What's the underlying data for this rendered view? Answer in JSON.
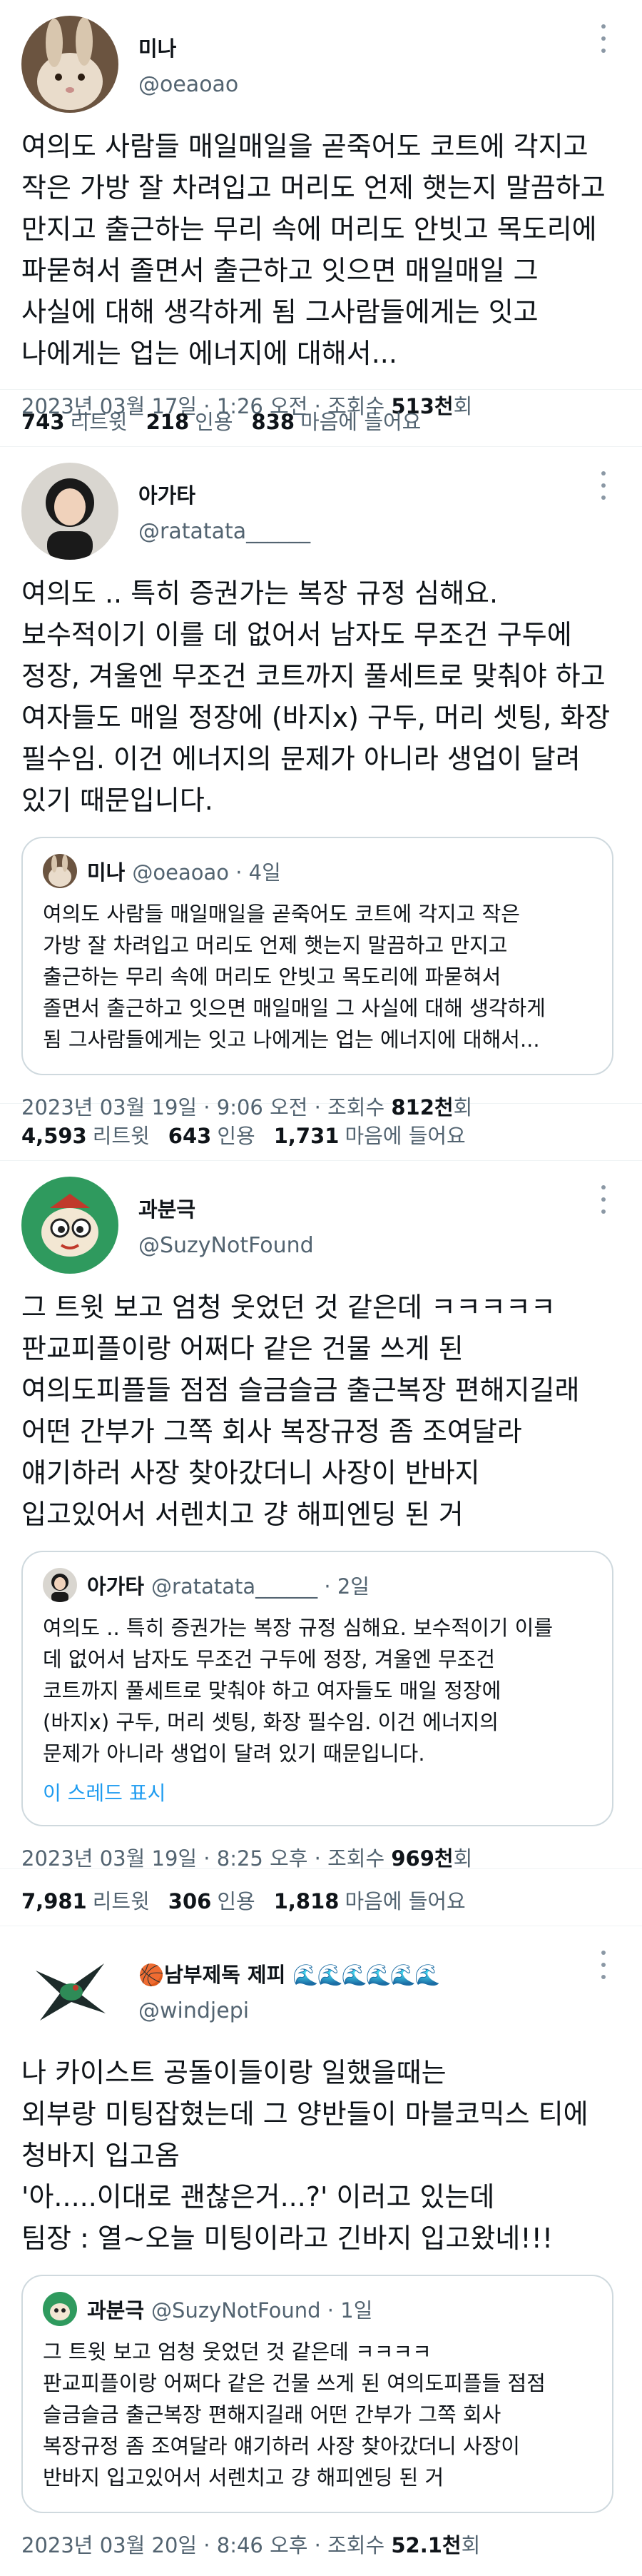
{
  "tweets": [
    {
      "name": "미나",
      "handle": "@oeaoao",
      "text": "여의도 사람들 매일매일을 곧죽어도 코트에 각지고\n작은 가방 잘 차려입고 머리도 언제 햇는지 말끔하고\n만지고 출근하는 무리 속에 머리도 안빗고 목도리에\n파묻혀서 졸면서 출근하고 잇으면 매일매일 그\n사실에 대해 생각하게 됨 그사람들에게는 잇고\n나에게는 업는 에너지에 대해서...",
      "meta_time": "2023년 03월 17일 · 1:26 오전 · 조회수 ",
      "views": "513천",
      "views_suffix": "회",
      "retweets": "743",
      "retweets_label": "리트윗",
      "quotes": "218",
      "quotes_label": "인용",
      "likes": "838",
      "likes_label": "마음에 들어요"
    },
    {
      "name": "아가타",
      "handle": "@ratatata______",
      "text": "여의도 .. 특히 증권가는 복장 규정 심해요.\n보수적이기 이를 데 없어서 남자도 무조건 구두에\n정장, 겨울엔 무조건 코트까지 풀세트로 맞춰야 하고\n여자들도 매일 정장에 (바지x) 구두, 머리 셋팅, 화장\n필수임. 이건 에너지의 문제가 아니라 생업이 달려\n있기 때문입니다.",
      "quote": {
        "name": "미나",
        "handle": "@oeaoao · 4일",
        "text": "여의도 사람들 매일매일을 곧죽어도 코트에 각지고 작은\n가방 잘 차려입고 머리도 언제 햇는지 말끔하고 만지고\n출근하는 무리 속에 머리도 안빗고 목도리에 파묻혀서\n졸면서 출근하고 잇으면 매일매일 그 사실에 대해 생각하게\n됨 그사람들에게는 잇고 나에게는 업는 에너지에 대해서..."
      },
      "meta_time": "2023년 03월 19일 · 9:06 오전 · 조회수 ",
      "views": "812천",
      "views_suffix": "회",
      "retweets": "4,593",
      "retweets_label": "리트윗",
      "quotes": "643",
      "quotes_label": "인용",
      "likes": "1,731",
      "likes_label": "마음에 들어요"
    },
    {
      "name": "과분극",
      "handle": "@SuzyNotFound",
      "text": "그 트윗 보고 엄청 웃었던 것 같은데 ㅋㅋㅋㅋㅋ\n판교피플이랑 어쩌다 같은 건물 쓰게 된\n여의도피플들 점점 슬금슬금 출근복장 편해지길래\n어떤 간부가 그쪽 회사 복장규정 좀 조여달라\n얘기하러 사장 찾아갔더니 사장이 반바지\n입고있어서 서렌치고 걍 해피엔딩 된 거",
      "quote": {
        "name": "아가타",
        "handle": "@ratatata______ · 2일",
        "text": "여의도 .. 특히 증권가는 복장 규정 심해요. 보수적이기 이를\n데 없어서 남자도 무조건 구두에 정장, 겨울엔 무조건\n코트까지 풀세트로 맞춰야 하고 여자들도 매일 정장에\n(바지x) 구두, 머리 셋팅, 화장 필수임. 이건 에너지의\n문제가 아니라 생업이 달려 있기 때문입니다.",
        "link": "이 스레드 표시"
      },
      "meta_time": "2023년 03월 19일 · 8:25 오후 · 조회수 ",
      "views": "969천",
      "views_suffix": "회",
      "retweets": "7,981",
      "retweets_label": "리트윗",
      "quotes": "306",
      "quotes_label": "인용",
      "likes": "1,818",
      "likes_label": "마음에 들어요"
    },
    {
      "name": "남부제독 제피",
      "name_emoji": "🏀",
      "name_waves": "🌊🌊🌊🌊🌊🌊",
      "handle": "@windjepi",
      "text": "나 카이스트 공돌이들이랑 일했을때는\n외부랑 미팅잡혔는데 그 양반들이 마블코믹스 티에\n청바지 입고옴\n'아.....이대로 괜찮은거...?' 이러고 있는데\n팀장 : 열~오늘 미팅이라고 긴바지 입고왔네!!!",
      "quote": {
        "name": "과분극",
        "handle": "@SuzyNotFound · 1일",
        "text": "그 트윗 보고 엄청 웃었던 것 같은데 ㅋㅋㅋㅋ\n판교피플이랑 어쩌다 같은 건물 쓰게 된 여의도피플들 점점\n슬금슬금 출근복장 편해지길래 어떤 간부가 그쪽 회사\n복장규정 좀 조여달라 얘기하러 사장 찾아갔더니 사장이\n반바지 입고있어서 서렌치고 걍 해피엔딩 된 거"
      },
      "meta_time": "2023년 03월 20일 · 8:46 오후 · 조회수 ",
      "views": "52.1천",
      "views_suffix": "회"
    }
  ]
}
